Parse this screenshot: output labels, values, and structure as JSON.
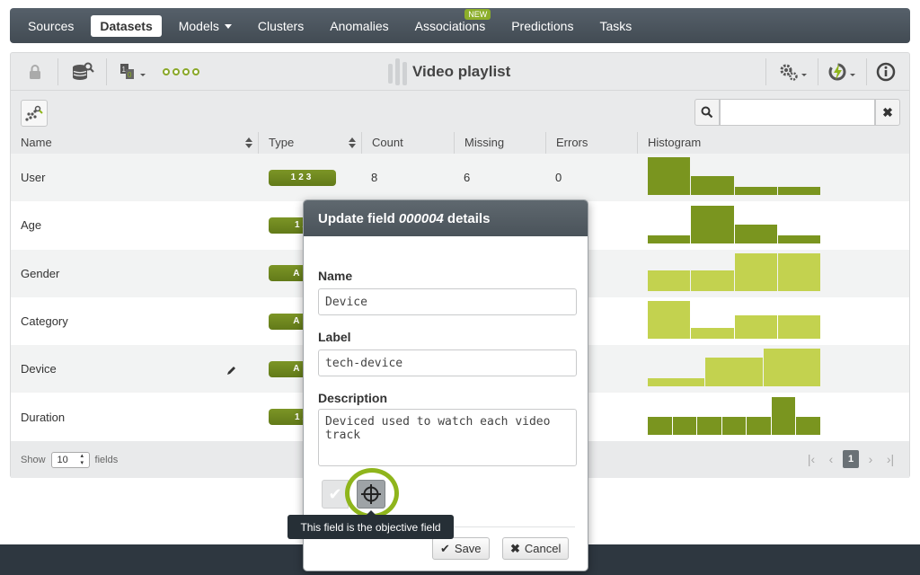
{
  "nav": {
    "items": [
      {
        "label": "Sources",
        "active": false
      },
      {
        "label": "Datasets",
        "active": true
      },
      {
        "label": "Models",
        "active": false,
        "dropdown": true
      },
      {
        "label": "Clusters",
        "active": false
      },
      {
        "label": "Anomalies",
        "active": false
      },
      {
        "label": "Associations",
        "active": false,
        "badge": "NEW"
      },
      {
        "label": "Predictions",
        "active": false
      },
      {
        "label": "Tasks",
        "active": false
      }
    ]
  },
  "toolbar": {
    "title": "Video playlist",
    "icons": [
      "lock-icon",
      "dataset-search-icon",
      "binary-dropdown-icon",
      "dots-icon",
      "gear-dropdown-icon",
      "lightning-dropdown-icon",
      "info-icon"
    ]
  },
  "search": {
    "placeholder": "",
    "value": ""
  },
  "table": {
    "columns": [
      "Name",
      "Type",
      "Count",
      "Missing",
      "Errors",
      "Histogram"
    ],
    "rows": [
      {
        "name": "User",
        "type": "123",
        "count": "8",
        "missing": "6",
        "errors": "0",
        "histogram": [
          1.0,
          0.5,
          0.22,
          0.22
        ],
        "hist_color": "#7a951f"
      },
      {
        "name": "Age",
        "type": "12",
        "count": "",
        "missing": "",
        "errors": "",
        "histogram": [
          0.22,
          1.0,
          0.5,
          0.22
        ],
        "hist_color": "#7a951f"
      },
      {
        "name": "Gender",
        "type": "AB",
        "count": "",
        "missing": "",
        "errors": "",
        "histogram": [
          0.55,
          0.55,
          1.0,
          1.0
        ],
        "hist_color": "#c3d24f"
      },
      {
        "name": "Category",
        "type": "AB",
        "count": "",
        "missing": "",
        "errors": "",
        "histogram": [
          1.0,
          0.28,
          0.62,
          0.62
        ],
        "hist_color": "#c3d24f"
      },
      {
        "name": "Device",
        "type": "AB",
        "count": "",
        "missing": "",
        "errors": "",
        "histogram": [
          0.22,
          0.75,
          1.0
        ],
        "hist_color": "#c3d24f",
        "editing": true
      },
      {
        "name": "Duration",
        "type": "12",
        "count": "",
        "missing": "",
        "errors": "",
        "histogram": [
          0.47,
          0.47,
          0.47,
          0.47,
          0.47,
          1.0,
          0.47
        ],
        "hist_color": "#7a951f"
      }
    ]
  },
  "footer": {
    "show_label": "Show",
    "show_value": "10",
    "fields_label": "fields",
    "current_page": "1"
  },
  "modal": {
    "title_prefix": "Update field",
    "field_id": "000004",
    "title_suffix": "details",
    "name_label": "Name",
    "name_value": "Device",
    "label_label": "Label",
    "label_value": "tech-device",
    "description_label": "Description",
    "description_value": "Deviced used to watch each video track",
    "save_label": "Save",
    "cancel_label": "Cancel"
  },
  "tooltip": {
    "text": "This field is the objective field"
  },
  "colors": {
    "accent": "#8fb51c",
    "nav_bg": "#4b545c",
    "badge": "#6a8320"
  }
}
